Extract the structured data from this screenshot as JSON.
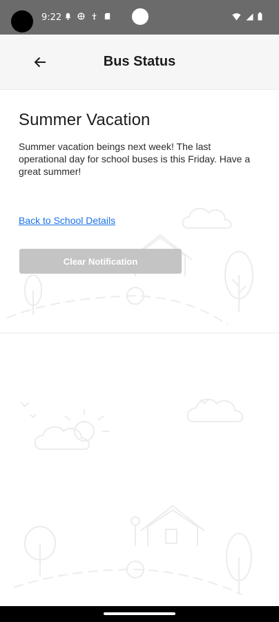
{
  "status_bar": {
    "time": "9:22",
    "left_icons": [
      "notification-bell-icon",
      "vpn-globe-icon",
      "usb-icon",
      "sd-card-icon"
    ],
    "right_icons": [
      "wifi-icon",
      "cell-signal-icon",
      "battery-icon"
    ]
  },
  "app_bar": {
    "title": "Bus Status",
    "back_icon": "arrow-left-icon"
  },
  "notice": {
    "title": "Summer Vacation",
    "body": "Summer vacation beings next week! The last operational day for school buses is this Friday. Have a great summer!"
  },
  "actions": {
    "back_link_label": "Back to School Details",
    "clear_button_label": "Clear Notification"
  },
  "colors": {
    "status_bar": "#6b6b6b",
    "app_bar": "#f6f6f6",
    "link": "#1a73e8",
    "button_disabled": "#c4c4c4"
  }
}
